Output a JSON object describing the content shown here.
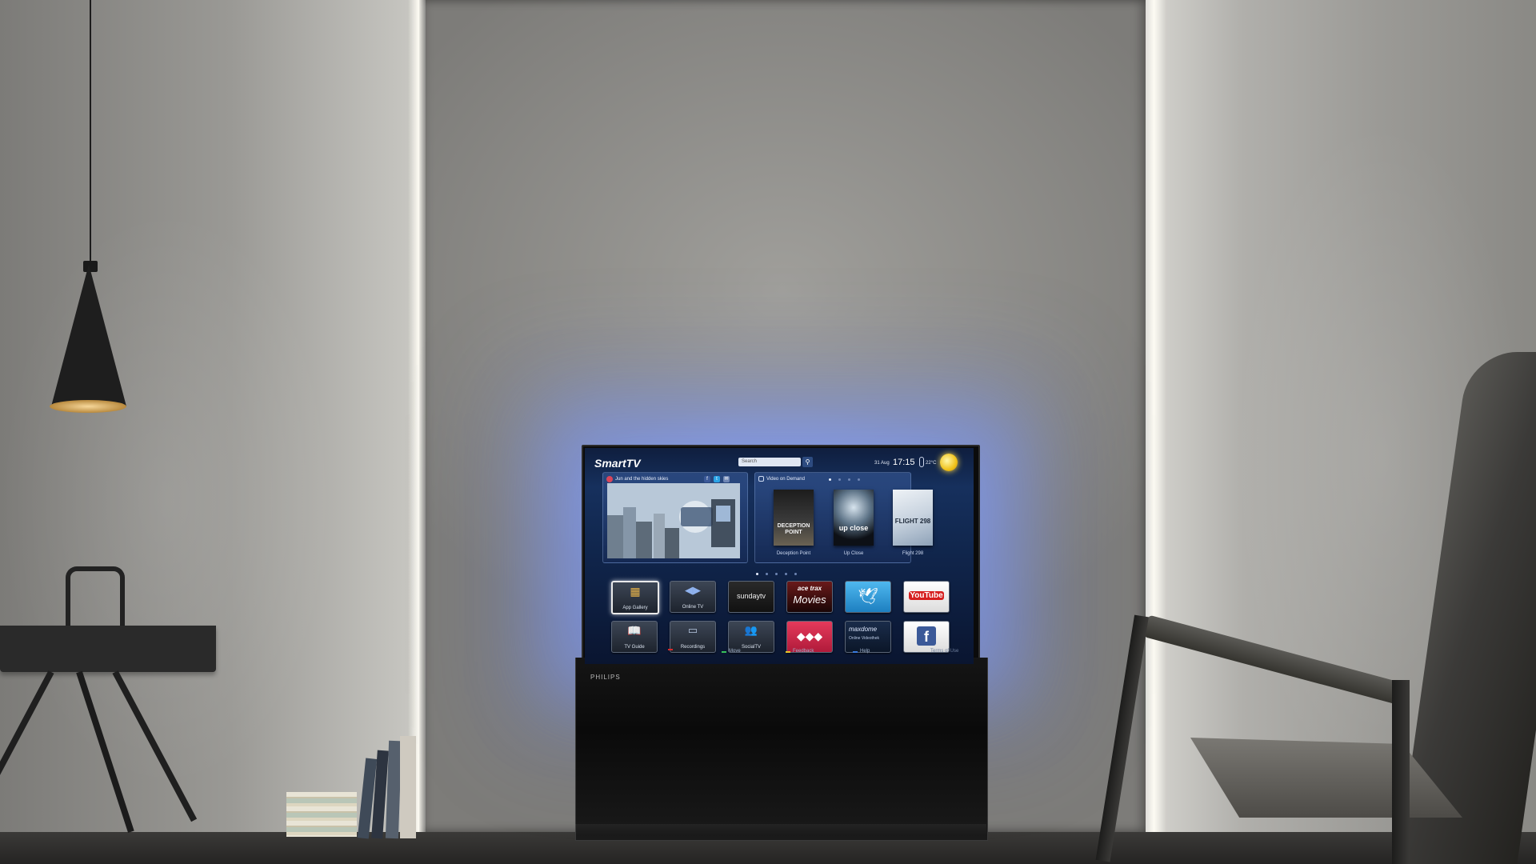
{
  "tv": {
    "brand": "PHILIPS",
    "ui_title": "SmartTV",
    "search_placeholder": "Search",
    "date": "31 Aug",
    "time": "17:15",
    "temperature": "22°C",
    "featured": {
      "title": "Jun and the hidden skies"
    },
    "vod": {
      "title": "Video on Demand",
      "items": [
        {
          "poster_text": "DECEPTION POINT",
          "caption": "Deception Point"
        },
        {
          "poster_text": "up close",
          "caption": "Up Close"
        },
        {
          "poster_text": "FLIGHT 298",
          "caption": "Flight 298"
        }
      ]
    },
    "apps_row1": [
      {
        "label": "App Gallery",
        "icon": "app-gallery-icon"
      },
      {
        "label": "Online TV",
        "icon": "online-tv-icon"
      },
      {
        "label": "sundaytv",
        "icon": "sundaytv-logo"
      },
      {
        "label": "Movies",
        "icon": "acetrax-movies-logo"
      },
      {
        "label": "",
        "icon": "twitter-icon"
      },
      {
        "label": "YouTube",
        "icon": "youtube-logo"
      }
    ],
    "apps_row2": [
      {
        "label": "TV Guide",
        "icon": "tv-guide-icon"
      },
      {
        "label": "Recordings",
        "icon": "recordings-icon"
      },
      {
        "label": "SocialTV",
        "icon": "social-tv-icon"
      },
      {
        "label": "",
        "icon": "vimeo-style-icon"
      },
      {
        "label": "maxdome",
        "icon": "maxdome-logo"
      },
      {
        "label": "f",
        "icon": "facebook-icon"
      }
    ],
    "acetrax_top": "ace trax",
    "maxdome_sub": "Online Videothek",
    "hints": {
      "move": "Move",
      "feedback": "Feedback",
      "help": "Help",
      "terms": "Terms of Use"
    },
    "colors": {
      "ambilight": "#7d9bff",
      "screen_bg": "#13284f",
      "twitter": "#2aa3e6",
      "youtube": "#d61f1f",
      "facebook": "#3b5998"
    }
  }
}
